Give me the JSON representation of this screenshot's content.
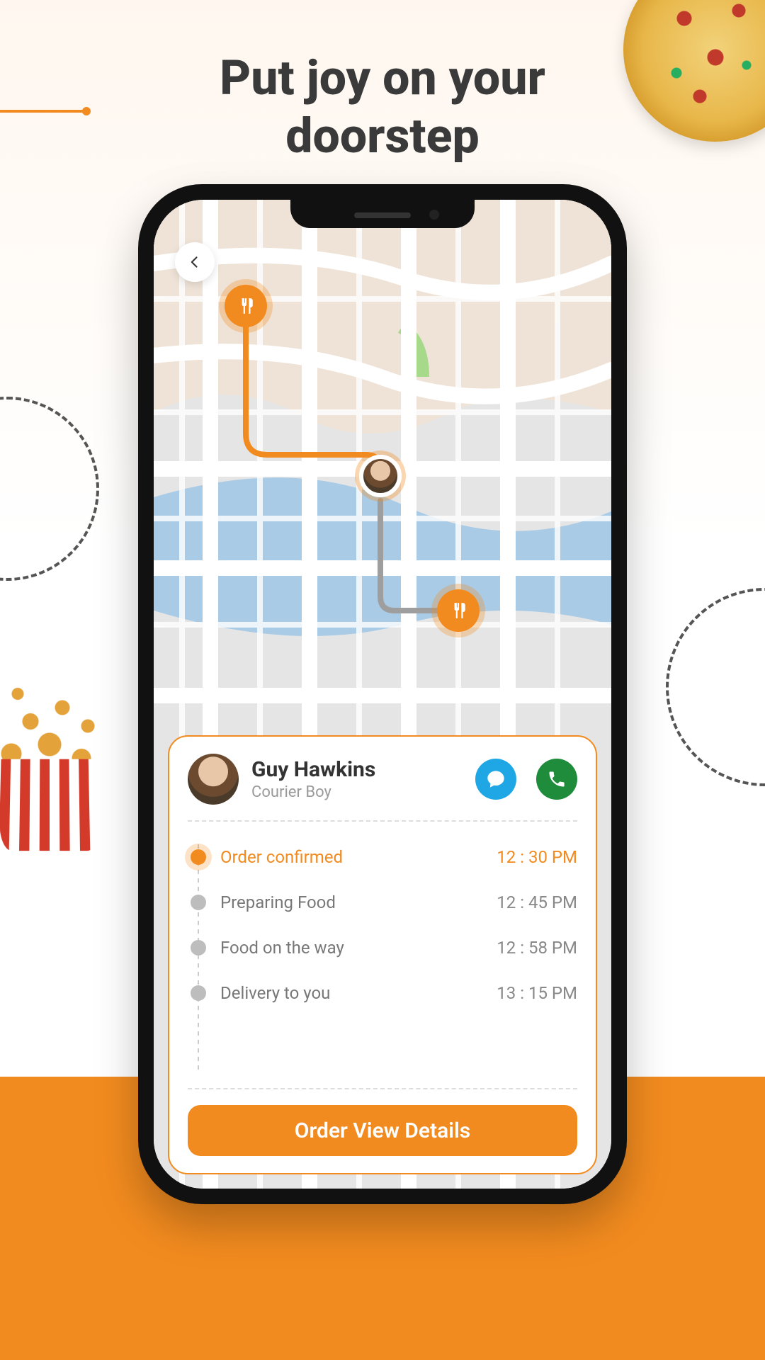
{
  "headline_line1": "Put joy on your",
  "headline_line2": "doorstep",
  "courier": {
    "name": "Guy Hawkins",
    "role": "Courier Boy"
  },
  "steps": [
    {
      "label": "Order confirmed",
      "time": "12 : 30 PM",
      "active": true
    },
    {
      "label": "Preparing Food",
      "time": "12 : 45 PM",
      "active": false
    },
    {
      "label": "Food on the way",
      "time": "12 : 58 PM",
      "active": false
    },
    {
      "label": "Delivery to you",
      "time": "13 : 15 PM",
      "active": false
    }
  ],
  "cta_label": "Order View Details"
}
